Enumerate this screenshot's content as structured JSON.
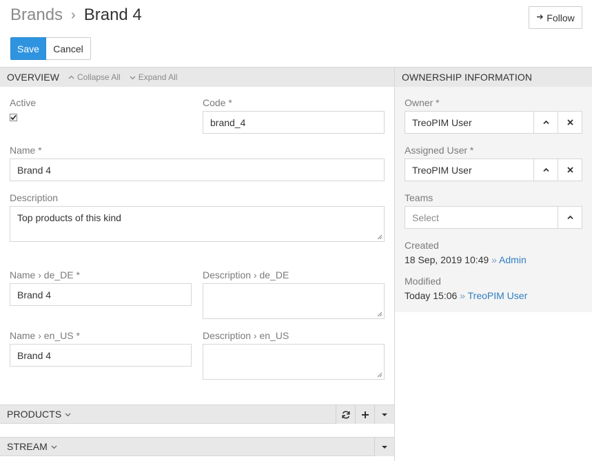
{
  "header": {
    "breadcrumb_parent": "Brands",
    "breadcrumb_separator": "›",
    "breadcrumb_current": "Brand 4",
    "follow_label": "Follow"
  },
  "actions": {
    "save_label": "Save",
    "cancel_label": "Cancel"
  },
  "overview": {
    "title": "OVERVIEW",
    "collapse_all": "Collapse All",
    "expand_all": "Expand All",
    "active_label": "Active",
    "active_checked": true,
    "code_label": "Code *",
    "code_value": "brand_4",
    "name_label": "Name *",
    "name_value": "Brand 4",
    "description_label": "Description",
    "description_value": "Top products of this kind",
    "name_de_label": "Name › de_DE *",
    "name_de_value": "Brand 4",
    "description_de_label": "Description › de_DE",
    "description_de_value": "",
    "name_en_label": "Name › en_US *",
    "name_en_value": "Brand 4",
    "description_en_label": "Description › en_US",
    "description_en_value": ""
  },
  "ownership": {
    "title": "OWNERSHIP INFORMATION",
    "owner_label": "Owner *",
    "owner_value": "TreoPIM User",
    "assigned_label": "Assigned User *",
    "assigned_value": "TreoPIM User",
    "teams_label": "Teams",
    "teams_placeholder": "Select",
    "created_label": "Created",
    "created_date": "18 Sep, 2019 10:49",
    "created_sep": "»",
    "created_by": "Admin",
    "modified_label": "Modified",
    "modified_date": "Today 15:06",
    "modified_sep": "»",
    "modified_by": "TreoPIM User"
  },
  "panels": {
    "products_title": "PRODUCTS",
    "stream_title": "STREAM"
  },
  "icons": {
    "follow": "arrow-right-icon",
    "collapse": "chevron-up-icon",
    "expand": "chevron-down-icon",
    "select": "chevron-up-icon",
    "clear": "close-icon",
    "refresh": "refresh-icon",
    "add": "plus-icon",
    "menu": "caret-down-icon"
  },
  "colors": {
    "primary": "#2f94e0",
    "link": "#2f7ec4",
    "panel_header": "#e8e8e8",
    "side_panel": "#f4f4f4"
  }
}
